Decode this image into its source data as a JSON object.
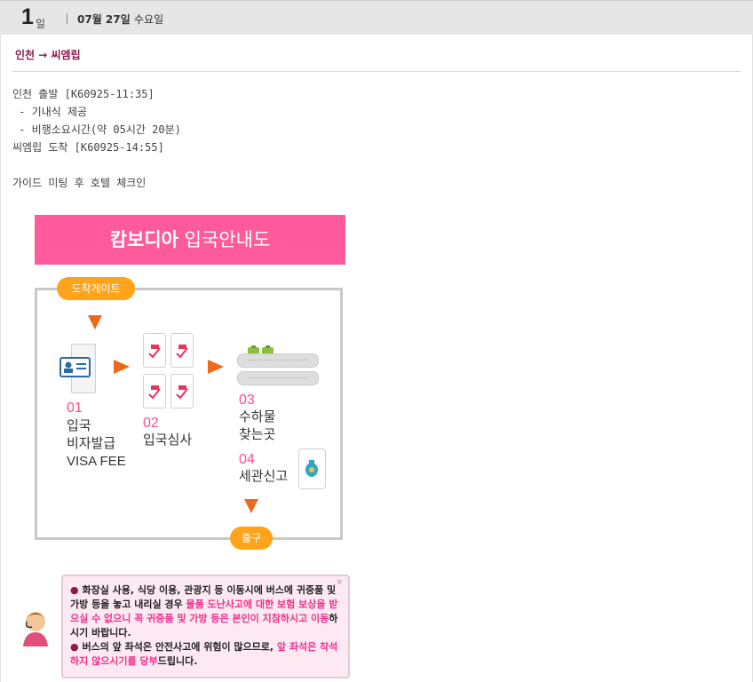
{
  "header": {
    "day_num": "1",
    "day_unit": "일",
    "date": "07월 27일",
    "weekday": "수요일"
  },
  "route": "인천 → 씨엠립",
  "schedule": [
    "인천 출발 [K60925-11:35]",
    " - 기내식 제공",
    " - 비행소요시간(약 05시간 20분)",
    "씨엠립 도착 [K60925-14:55]",
    "가이드 미팅 후 호텔 체크인"
  ],
  "guide": {
    "title_bold": "캄보디아",
    "title_rest": " 입국안내도",
    "start": "도착게이트",
    "end": "출구",
    "steps": [
      {
        "num": "01",
        "label_lines": [
          "입국",
          "비자발급",
          "VISA FEE"
        ]
      },
      {
        "num": "02",
        "label_lines": [
          "입국심사"
        ]
      },
      {
        "num": "03",
        "label_lines": [
          "수하물",
          "찾는곳"
        ]
      },
      {
        "num": "04",
        "label_lines": [
          "세관신고"
        ]
      }
    ],
    "icons": [
      "id-card-icon",
      "passport-control-icon",
      "luggage-icon",
      "money-bag-icon"
    ]
  },
  "notice": {
    "close": "×",
    "bullet": "●",
    "item1_a": "화장실 사용, 식당 이용, 관광지 등 이동시에 버스에 귀중품 및 가방 등을 놓고 내리실 경우 ",
    "item1_pink": "물품 도난사고에 대한 보험 보상을 받으실 수 없으니 꼭 귀중품 및 가방 등은 본인이 지참하시고 이동",
    "item1_b": "하시기 바랍니다.",
    "item2_a": "버스의 앞 좌석은 안전사고에 위험이 많으므로, ",
    "item2_pink": "앞 좌석은 착석하지 않으시기를 당부",
    "item2_b": "드립니다."
  },
  "colors": {
    "banner": "#ff5a9b",
    "accent": "#ffa31a",
    "arrow": "#ee6a1a",
    "route": "#8c1a4a"
  }
}
